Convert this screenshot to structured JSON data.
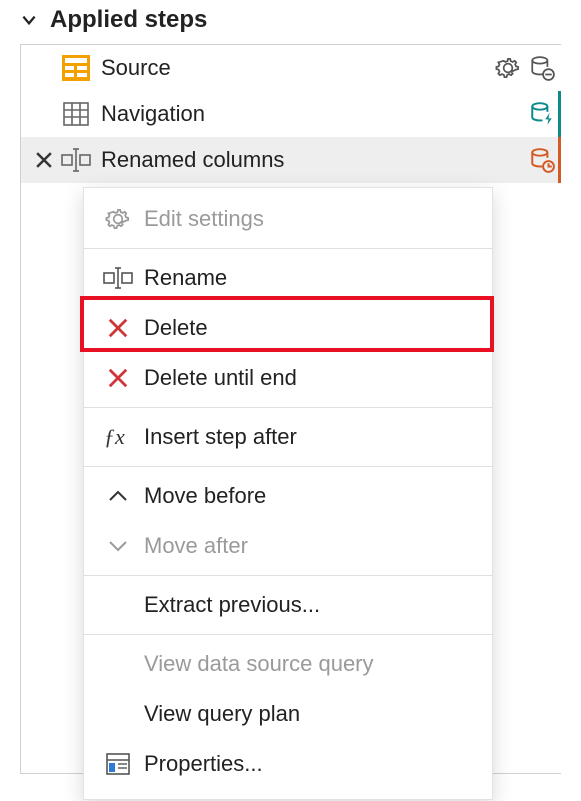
{
  "header": {
    "title": "Applied steps"
  },
  "steps": [
    {
      "label": "Source"
    },
    {
      "label": "Navigation"
    },
    {
      "label": "Renamed columns"
    }
  ],
  "context_menu": {
    "edit_settings": "Edit settings",
    "rename": "Rename",
    "delete": "Delete",
    "delete_until_end": "Delete until end",
    "insert_step_after": "Insert step after",
    "move_before": "Move before",
    "move_after": "Move after",
    "extract_previous": "Extract previous...",
    "view_data_source_query": "View data source query",
    "view_query_plan": "View query plan",
    "properties": "Properties..."
  }
}
